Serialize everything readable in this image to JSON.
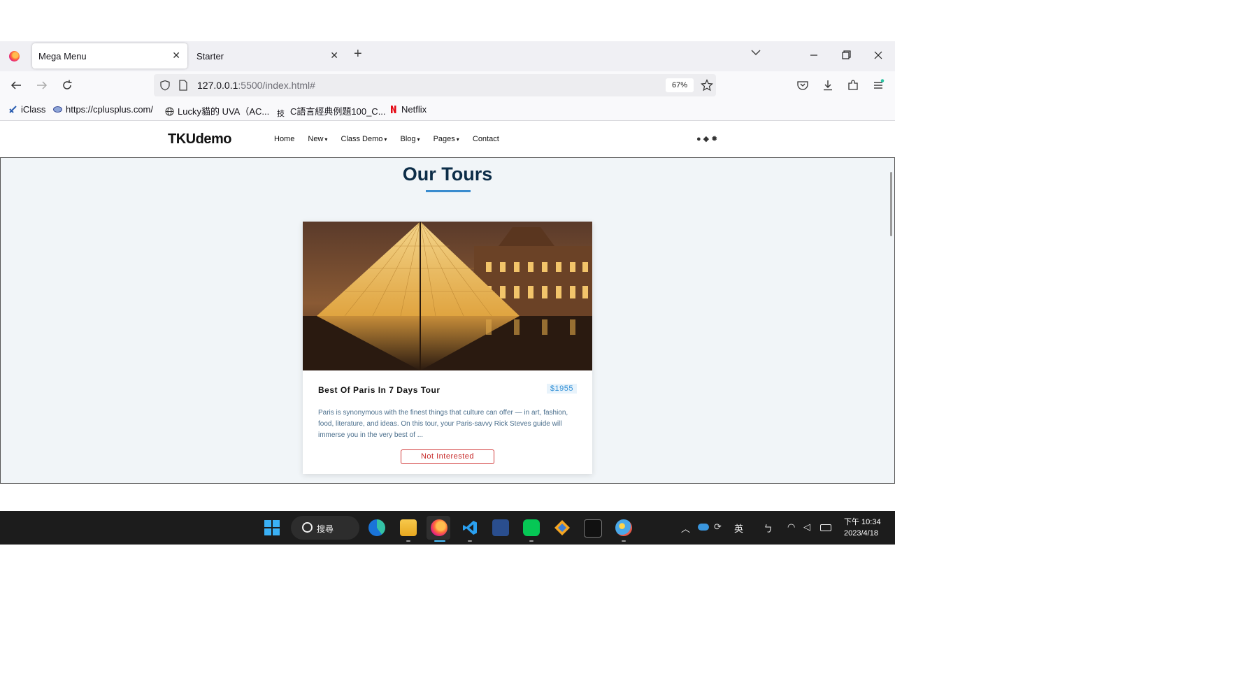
{
  "browser": {
    "tabs": [
      {
        "title": "Mega Menu",
        "active": true
      },
      {
        "title": "Starter",
        "active": false
      }
    ],
    "new_tab": "+",
    "close": "✕",
    "url_host": "127.0.0.1",
    "url_path": ":5500/index.html#",
    "zoom": "67%",
    "bookmarks": [
      {
        "label": "iClass"
      },
      {
        "label": "https://cplusplus.com/"
      },
      {
        "label": "Lucky貓的 UVA（AC..."
      },
      {
        "label": "C語言經典例題100_C..."
      },
      {
        "label": "Netflix"
      }
    ]
  },
  "site": {
    "brand": "TKUdemo",
    "menu": [
      {
        "label": "Home"
      },
      {
        "label": "New"
      },
      {
        "label": "Class Demo"
      },
      {
        "label": "Blog"
      },
      {
        "label": "Pages"
      },
      {
        "label": "Contact"
      }
    ],
    "section_title": "Our Tours",
    "card": {
      "title": "Best Of Paris In 7 Days Tour",
      "price": "$1955",
      "description": "Paris is synonymous with the finest things that culture can offer — in art, fashion, food, literature, and ideas. On this tour, your Paris-savvy Rick Steves guide will immerse you in the very best of ...",
      "button": "Not Interested"
    }
  },
  "taskbar": {
    "search": "搜尋",
    "ime": "英",
    "ime2": "ㄅ",
    "time": "下午 10:34",
    "date": "2023/4/18"
  },
  "colors": {
    "accent": "#3a8ccf",
    "title": "#0c2d48",
    "price": "#2f8ed6",
    "danger": "#c62828"
  }
}
